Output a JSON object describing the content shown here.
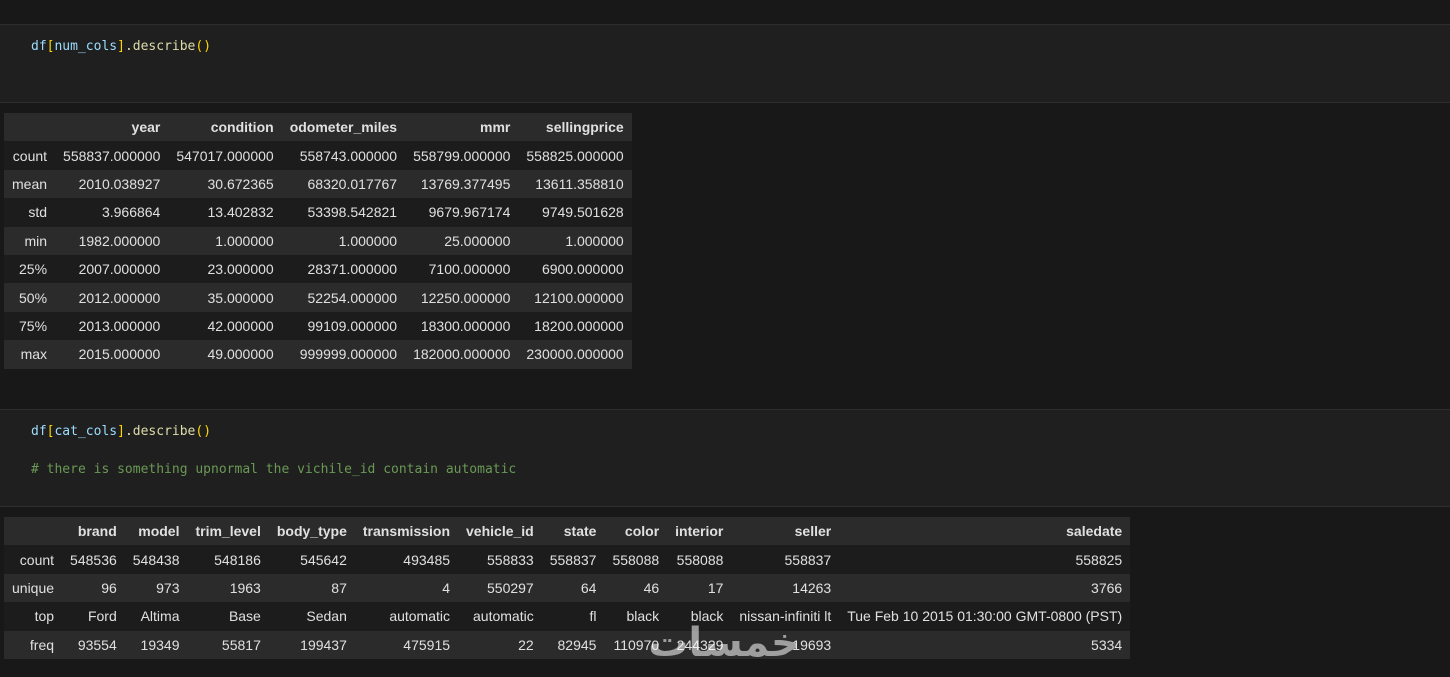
{
  "cell1": {
    "code": {
      "df": "df",
      "open": "[",
      "arg": "num_cols",
      "close": "]",
      "method": ".describe",
      "paren_open": "(",
      "paren_close": ")"
    }
  },
  "table1": {
    "columns": [
      "year",
      "condition",
      "odometer_miles",
      "mmr",
      "sellingprice"
    ],
    "rows": [
      {
        "label": "count",
        "values": [
          "558837.000000",
          "547017.000000",
          "558743.000000",
          "558799.000000",
          "558825.000000"
        ]
      },
      {
        "label": "mean",
        "values": [
          "2010.038927",
          "30.672365",
          "68320.017767",
          "13769.377495",
          "13611.358810"
        ]
      },
      {
        "label": "std",
        "values": [
          "3.966864",
          "13.402832",
          "53398.542821",
          "9679.967174",
          "9749.501628"
        ]
      },
      {
        "label": "min",
        "values": [
          "1982.000000",
          "1.000000",
          "1.000000",
          "25.000000",
          "1.000000"
        ]
      },
      {
        "label": "25%",
        "values": [
          "2007.000000",
          "23.000000",
          "28371.000000",
          "7100.000000",
          "6900.000000"
        ]
      },
      {
        "label": "50%",
        "values": [
          "2012.000000",
          "35.000000",
          "52254.000000",
          "12250.000000",
          "12100.000000"
        ]
      },
      {
        "label": "75%",
        "values": [
          "2013.000000",
          "42.000000",
          "99109.000000",
          "18300.000000",
          "18200.000000"
        ]
      },
      {
        "label": "max",
        "values": [
          "2015.000000",
          "49.000000",
          "999999.000000",
          "182000.000000",
          "230000.000000"
        ]
      }
    ]
  },
  "cell2": {
    "code": {
      "df": "df",
      "open": "[",
      "arg": "cat_cols",
      "close": "]",
      "method": ".describe",
      "paren_open": "(",
      "paren_close": ")"
    },
    "comment": "# there is something upnormal the vichile_id contain automatic"
  },
  "table2": {
    "columns": [
      "brand",
      "model",
      "trim_level",
      "body_type",
      "transmission",
      "vehicle_id",
      "state",
      "color",
      "interior",
      "seller",
      "saledate"
    ],
    "rows": [
      {
        "label": "count",
        "values": [
          "548536",
          "548438",
          "548186",
          "545642",
          "493485",
          "558833",
          "558837",
          "558088",
          "558088",
          "558837",
          "558825"
        ]
      },
      {
        "label": "unique",
        "values": [
          "96",
          "973",
          "1963",
          "87",
          "4",
          "550297",
          "64",
          "46",
          "17",
          "14263",
          "3766"
        ]
      },
      {
        "label": "top",
        "values": [
          "Ford",
          "Altima",
          "Base",
          "Sedan",
          "automatic",
          "automatic",
          "fl",
          "black",
          "black",
          "nissan-infiniti lt",
          "Tue Feb 10 2015 01:30:00 GMT-0800 (PST)"
        ]
      },
      {
        "label": "freq",
        "values": [
          "93554",
          "19349",
          "55817",
          "199437",
          "475915",
          "22",
          "82945",
          "110970",
          "244329",
          "19693",
          "5334"
        ]
      }
    ]
  },
  "watermark": {
    "kind": "logo",
    "text": "خمسات"
  }
}
